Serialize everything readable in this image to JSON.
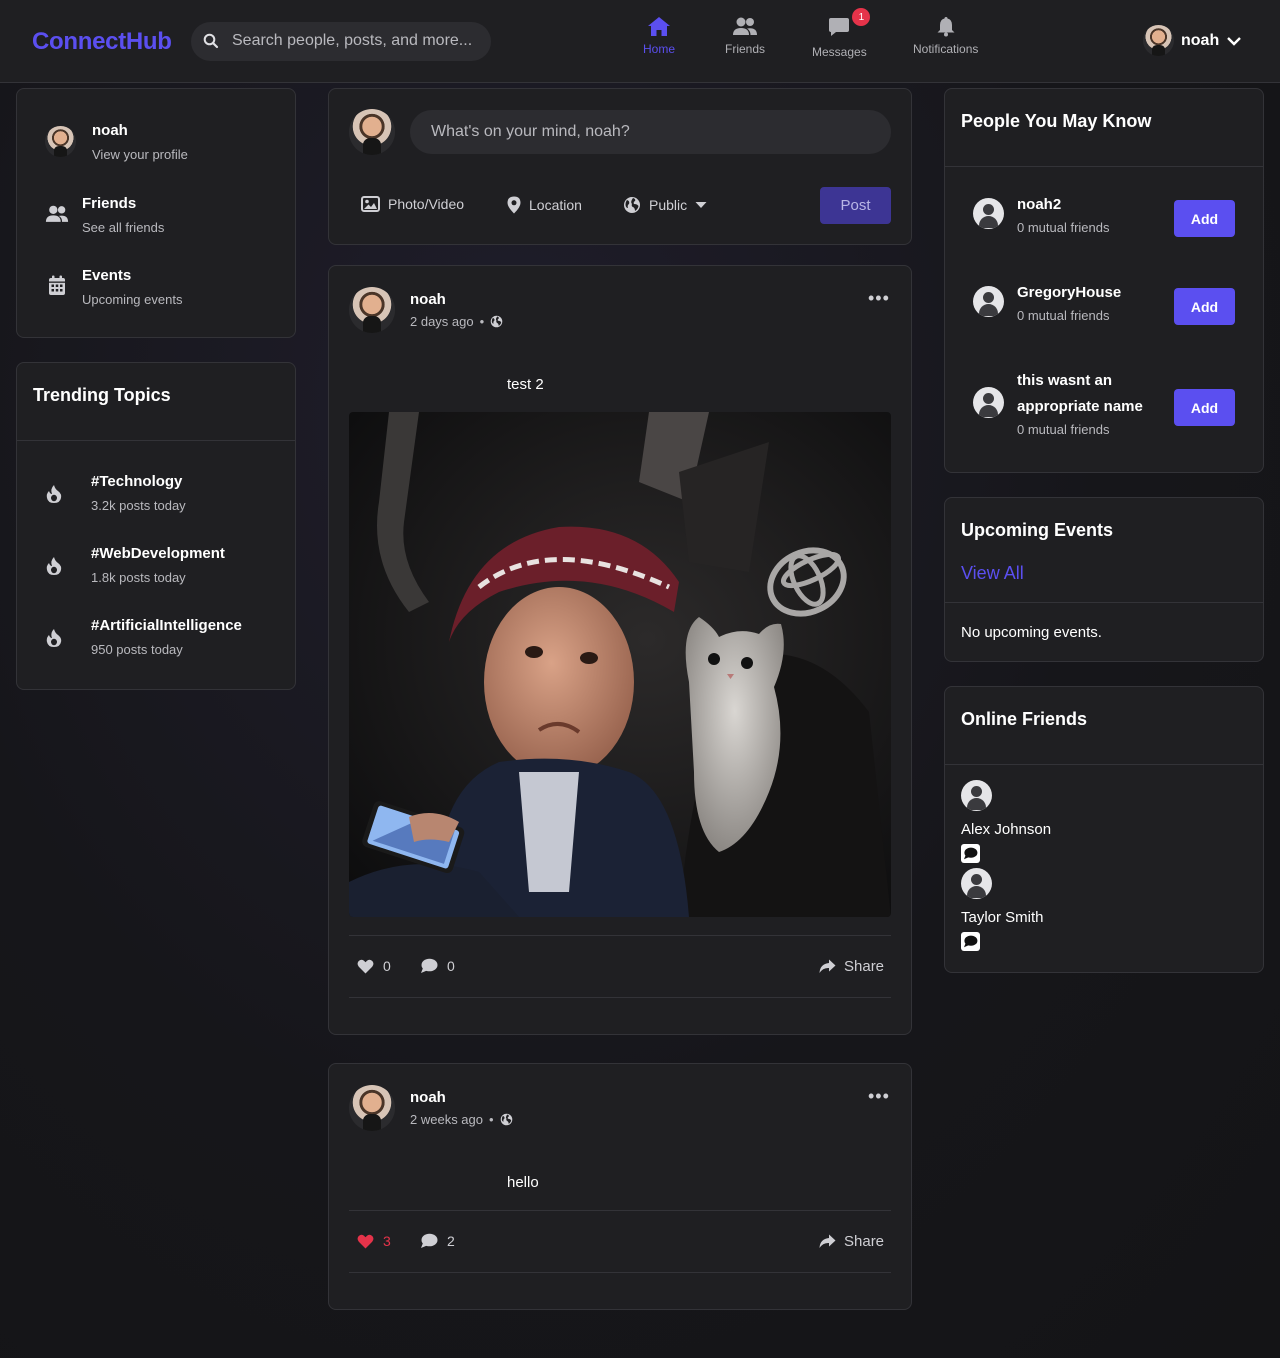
{
  "app": {
    "logo": "ConnectHub"
  },
  "search": {
    "placeholder": "Search people, posts, and more..."
  },
  "nav": {
    "home": "Home",
    "friends": "Friends",
    "messages": "Messages",
    "messages_badge": "1",
    "notifications": "Notifications"
  },
  "user": {
    "name": "noah"
  },
  "left": {
    "profile": {
      "name": "noah",
      "sub": "View your profile"
    },
    "friends": {
      "title": "Friends",
      "sub": "See all friends"
    },
    "events": {
      "title": "Events",
      "sub": "Upcoming events"
    },
    "trending_title": "Trending Topics",
    "trending": [
      {
        "tag": "#Technology",
        "count": "3.2k posts today"
      },
      {
        "tag": "#WebDevelopment",
        "count": "1.8k posts today"
      },
      {
        "tag": "#ArtificialIntelligence",
        "count": "950 posts today"
      }
    ]
  },
  "composer": {
    "placeholder": "What's on your mind, noah?",
    "photo": "Photo/Video",
    "location": "Location",
    "privacy": "Public",
    "post": "Post"
  },
  "posts": [
    {
      "author": "noah",
      "time": "2 days ago",
      "text": "test 2",
      "likes": "0",
      "comments": "0",
      "share": "Share"
    },
    {
      "author": "noah",
      "time": "2 weeks ago",
      "text": "hello",
      "likes": "3",
      "comments": "2",
      "share": "Share"
    }
  ],
  "right": {
    "pymk_title": "People You May Know",
    "suggestions": [
      {
        "name": "noah2",
        "mutual": "0 mutual friends",
        "action": "Add"
      },
      {
        "name": "GregoryHouse",
        "mutual": "0 mutual friends",
        "action": "Add"
      },
      {
        "name": "this wasnt an appropriate name",
        "mutual": "0 mutual friends",
        "action": "Add"
      }
    ],
    "events_title": "Upcoming Events",
    "events_view_all": "View All",
    "events_empty": "No upcoming events.",
    "online_title": "Online Friends",
    "online": [
      {
        "name": "Alex Johnson"
      },
      {
        "name": "Taylor Smith"
      }
    ]
  },
  "colors": {
    "accent": "#5b4ff0",
    "like": "#e5334a",
    "badge": "#e5334a"
  }
}
